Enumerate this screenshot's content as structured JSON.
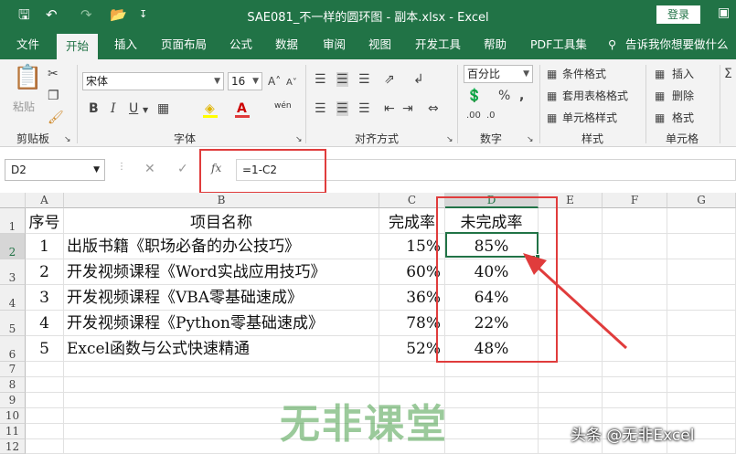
{
  "titlebar": {
    "title": "SAE081_不一样的圆环图 - 副本.xlsx  -  Excel",
    "login": "登录",
    "save_icon": "save-icon",
    "undo_icon": "undo-icon",
    "redo_icon": "redo-icon",
    "open_icon": "folder-open-icon"
  },
  "tabs": [
    {
      "label": "文件"
    },
    {
      "label": "开始"
    },
    {
      "label": "插入"
    },
    {
      "label": "页面布局"
    },
    {
      "label": "公式"
    },
    {
      "label": "数据"
    },
    {
      "label": "审阅"
    },
    {
      "label": "视图"
    },
    {
      "label": "开发工具"
    },
    {
      "label": "帮助"
    },
    {
      "label": "PDF工具集"
    },
    {
      "label": "告诉我你想要做什么"
    }
  ],
  "ribbon": {
    "paste_label": "粘贴",
    "clipboard_label": "剪贴板",
    "font_name": "宋体",
    "font_size": "16",
    "font_group_label": "字体",
    "align_group_label": "对齐方式",
    "number_format": "百分比",
    "number_group_label": "数字",
    "cond_format": "条件格式",
    "table_format": "套用表格格式",
    "cell_style": "单元格样式",
    "styles_group_label": "样式",
    "insert_label": "插入",
    "delete_label": "删除",
    "format_label": "格式",
    "cells_group_label": "单元格",
    "wen_label": "wén"
  },
  "formula_bar": {
    "name_box": "D2",
    "formula": "=1-C2"
  },
  "columns": [
    "A",
    "B",
    "C",
    "D",
    "E",
    "F",
    "G"
  ],
  "rows": [
    {
      "num": "1",
      "a": "序号",
      "b": "项目名称",
      "c": "完成率",
      "d": "未完成率"
    },
    {
      "num": "2",
      "a": "1",
      "b": "出版书籍《职场必备的办公技巧》",
      "c": "15%",
      "d": "85%"
    },
    {
      "num": "3",
      "a": "2",
      "b": "开发视频课程《Word实战应用技巧》",
      "c": "60%",
      "d": "40%"
    },
    {
      "num": "4",
      "a": "3",
      "b": "开发视频课程《VBA零基础速成》",
      "c": "36%",
      "d": "64%"
    },
    {
      "num": "5",
      "a": "4",
      "b": "开发视频课程《Python零基础速成》",
      "c": "78%",
      "d": "22%"
    },
    {
      "num": "6",
      "a": "5",
      "b": "Excel函数与公式快速精通",
      "c": "52%",
      "d": "48%"
    },
    {
      "num": "7",
      "a": "",
      "b": "",
      "c": "",
      "d": ""
    },
    {
      "num": "8",
      "a": "",
      "b": "",
      "c": "",
      "d": ""
    },
    {
      "num": "9",
      "a": "",
      "b": "",
      "c": "",
      "d": ""
    },
    {
      "num": "10",
      "a": "",
      "b": "",
      "c": "",
      "d": ""
    },
    {
      "num": "11",
      "a": "",
      "b": "",
      "c": "",
      "d": ""
    },
    {
      "num": "12",
      "a": "",
      "b": "",
      "c": "",
      "d": ""
    }
  ],
  "watermark": "无非课堂",
  "credit": "头条 @无非Excel",
  "colors": {
    "excel_green": "#217346",
    "highlight_red": "#e03c3c"
  }
}
